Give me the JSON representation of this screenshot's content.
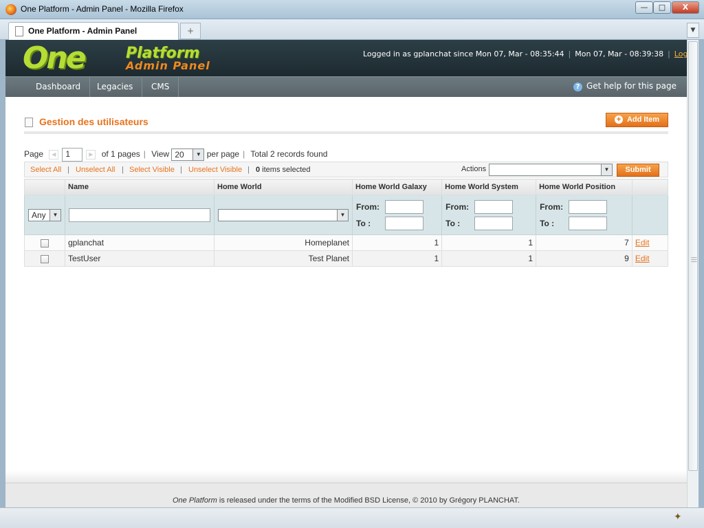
{
  "window": {
    "title": "One Platform - Admin Panel - Mozilla Firefox",
    "tab_label": "One Platform - Admin Panel",
    "new_tab_glyph": "+",
    "minimize": "—",
    "maximize": "□",
    "close": "X"
  },
  "header": {
    "logo": {
      "one": "One",
      "platform": "Platform",
      "admin": "Admin Panel"
    },
    "logged_in": "Logged in as gplanchat since Mon 07, Mar - 08:35:44",
    "current_time": "Mon 07, Mar - 08:39:38",
    "logout": "Log Out"
  },
  "nav": {
    "items": [
      {
        "label": "Dashboard"
      },
      {
        "label": "Legacies"
      },
      {
        "label": "CMS"
      }
    ],
    "help": "Get help for this page",
    "help_glyph": "?"
  },
  "page": {
    "title": "Gestion des utilisateurs",
    "add_item": "Add Item",
    "add_glyph": "+"
  },
  "pager": {
    "page_label": "Page",
    "page_value": "1",
    "of_pages": "of 1 pages",
    "view_label": "View",
    "view_value": "20",
    "per_page": "per page",
    "total": "Total 2 records found"
  },
  "massaction": {
    "select_all": "Select All",
    "unselect_all": "Unselect All",
    "select_visible": "Select Visible",
    "unselect_visible": "Unselect Visible",
    "selected_count": "0",
    "selected_suffix": " items selected",
    "actions_label": "Actions",
    "submit": "Submit"
  },
  "grid": {
    "columns": [
      "Name",
      "Home World",
      "Home World Galaxy",
      "Home World System",
      "Home World Position"
    ],
    "filter": {
      "any": "Any",
      "from": "From:",
      "to": "To :"
    },
    "rows": [
      {
        "name": "gplanchat",
        "home_world": "Homeplanet",
        "galaxy": "1",
        "system": "1",
        "position": "7",
        "action": "Edit"
      },
      {
        "name": "TestUser",
        "home_world": "Test Planet",
        "galaxy": "1",
        "system": "1",
        "position": "9",
        "action": "Edit"
      }
    ]
  },
  "footer": {
    "brand": "One Platform",
    "text": " is released under the terms of the Modified BSD License, © 2010 by Grégory PLANCHAT."
  }
}
